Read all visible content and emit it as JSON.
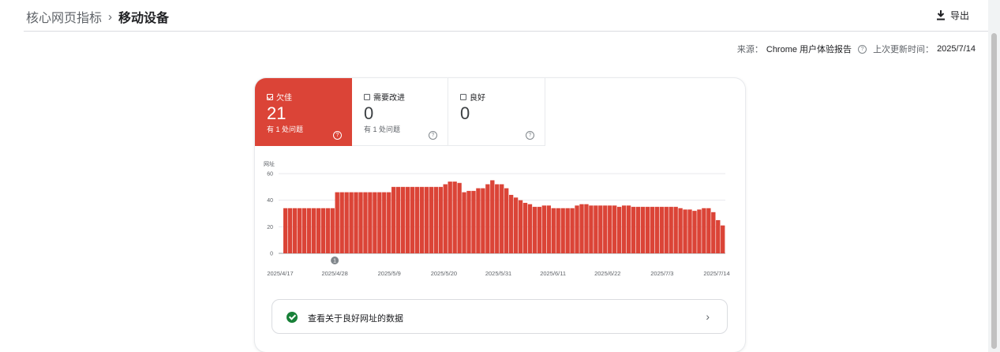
{
  "breadcrumb": {
    "parent": "核心网页指标",
    "separator": "›",
    "current": "移动设备"
  },
  "toolbar": {
    "export_label": "导出"
  },
  "source_line": {
    "source_label": "来源：",
    "source_value": "Chrome 用户体验报告",
    "updated_label": "上次更新时间：",
    "updated_value": "2025/7/14"
  },
  "tiles": [
    {
      "label": "欠佳",
      "value": "21",
      "sub": "有 1 处问题",
      "checked": true,
      "color": "#db4437"
    },
    {
      "label": "需要改进",
      "value": "0",
      "sub": "有 1 处问题",
      "checked": false
    },
    {
      "label": "良好",
      "value": "0",
      "sub": "",
      "checked": false
    }
  ],
  "chart_data": {
    "type": "bar",
    "ylabel": "网址",
    "ylim": [
      0,
      60
    ],
    "yticks": [
      0,
      20,
      40,
      60
    ],
    "xtick_labels": [
      "2025/4/17",
      "2025/4/28",
      "2025/5/9",
      "2025/5/20",
      "2025/5/31",
      "2025/6/11",
      "2025/6/22",
      "2025/7/3",
      "2025/7/14"
    ],
    "bar_color": "#db4437",
    "annotation": {
      "label": "1",
      "at": "2025/4/28"
    },
    "values": [
      34,
      34,
      34,
      34,
      34,
      34,
      34,
      34,
      34,
      34,
      34,
      46,
      46,
      46,
      46,
      46,
      46,
      46,
      46,
      46,
      46,
      46,
      46,
      50,
      50,
      50,
      50,
      50,
      50,
      50,
      50,
      50,
      50,
      50,
      52,
      54,
      54,
      53,
      46,
      47,
      47,
      49,
      49,
      52,
      55,
      52,
      52,
      49,
      44,
      42,
      40,
      38,
      37,
      35,
      35,
      36,
      36,
      34,
      34,
      34,
      34,
      34,
      36,
      37,
      37,
      36,
      36,
      36,
      36,
      36,
      36,
      35,
      36,
      36,
      35,
      35,
      35,
      35,
      35,
      35,
      35,
      35,
      35,
      35,
      34,
      33,
      33,
      32,
      33,
      34,
      34,
      31,
      25,
      21
    ]
  },
  "good_urls_link": {
    "label": "查看关于良好网址的数据"
  }
}
